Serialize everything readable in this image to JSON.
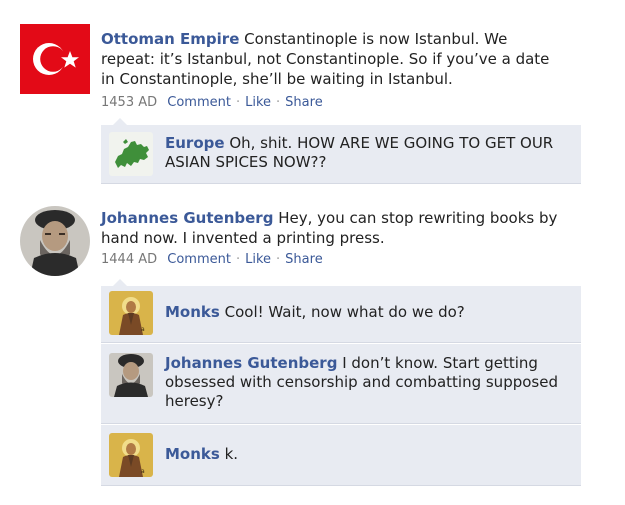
{
  "posts": [
    {
      "author": "Ottoman Empire",
      "text": "Constantinople is now Istanbul. We repeat: it’s Istanbul, not Constantinople. So if you’ve a date in Constantinople, she’ll be waiting in Istanbul.",
      "date": "1453 AD",
      "comment_label": "Comment",
      "like_label": "Like",
      "share_label": "Share",
      "avatar_icon": "turkish-flag-icon",
      "comments": [
        {
          "author": "Europe",
          "text": "Oh, shit. HOW ARE WE GOING TO GET OUR ASIAN SPICES NOW??",
          "avatar_icon": "europe-map-icon"
        }
      ]
    },
    {
      "author": "Johannes Gutenberg",
      "text": "Hey, you can stop rewriting books by hand now. I invented a printing press.",
      "date": "1444 AD",
      "comment_label": "Comment",
      "like_label": "Like",
      "share_label": "Share",
      "avatar_icon": "gutenberg-portrait-icon",
      "comments": [
        {
          "author": "Monks",
          "text": "Cool! Wait, now what do we do?",
          "avatar_icon": "monk-icon"
        },
        {
          "author": "Johannes Gutenberg",
          "text": "I don’t know. Start getting obsessed with censorship and combatting supposed heresy?",
          "avatar_icon": "gutenberg-portrait-icon"
        },
        {
          "author": "Monks",
          "text": "k.",
          "avatar_icon": "monk-icon"
        }
      ]
    }
  ],
  "colors": {
    "link": "#3b5998",
    "comment_bg": "#e8ebf2",
    "flag_red": "#e30a17"
  }
}
